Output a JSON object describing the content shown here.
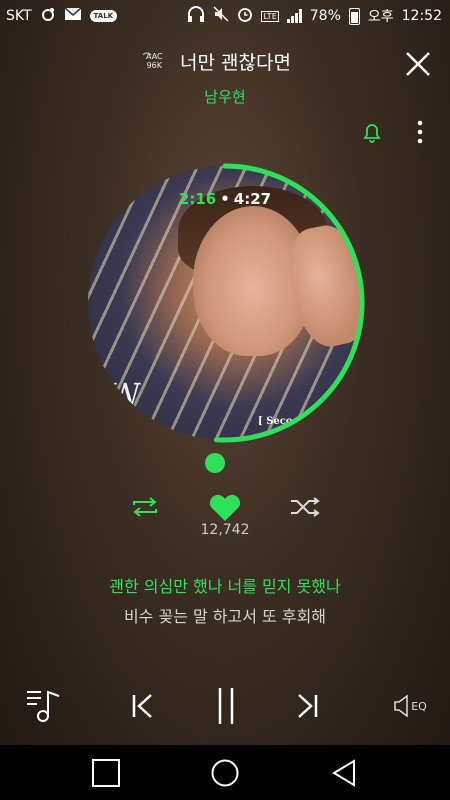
{
  "status": {
    "carrier": "SKT",
    "talk": "TALK",
    "lte": "LTE",
    "battery": "78%",
    "ampm": "오후",
    "time": "12:52"
  },
  "header": {
    "codec": "AAC",
    "bitrate": "96K",
    "title": "너만 괜찮다면",
    "artist": "남우현"
  },
  "album": {
    "logo_text": "W",
    "tag_text": "[ Seco"
  },
  "playback": {
    "current_time": "2:16",
    "separator": "•",
    "total_time": "4:27",
    "progress_fraction": 0.51
  },
  "likes": "12,742",
  "lyrics": {
    "current": "괜한 의심만 했나 너를 믿지 못했나",
    "next": "비수 꽂는 말 하고서 또 후회해"
  },
  "eq_label": "EQ",
  "colors": {
    "accent": "#2fe05a",
    "background": "#3a2c22"
  }
}
